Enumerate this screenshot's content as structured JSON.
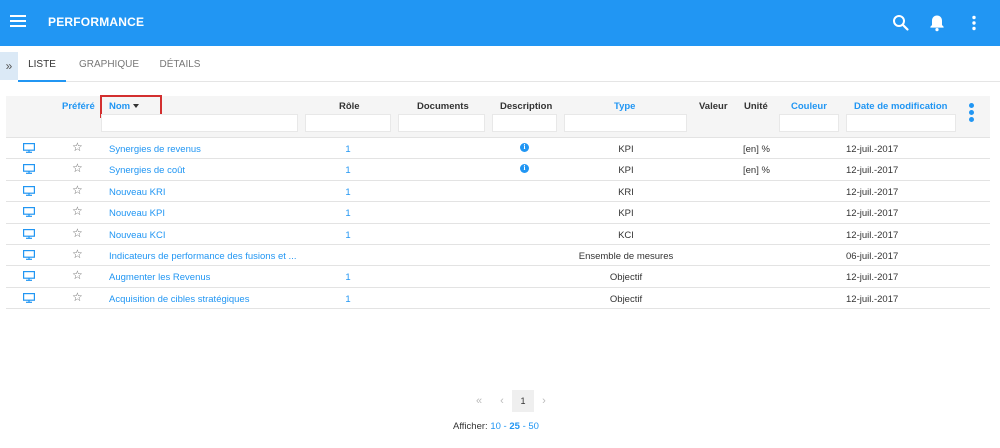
{
  "app": {
    "title": "PERFORMANCE",
    "accent_color": "#2196f3",
    "icons": [
      "menu-icon",
      "search-icon",
      "bell-icon",
      "more-vertical-icon"
    ]
  },
  "side_toggle": {
    "glyph": "»"
  },
  "tabs": [
    {
      "label": "LISTE",
      "active": true
    },
    {
      "label": "GRAPHIQUE",
      "active": false
    },
    {
      "label": "DÉTAILS",
      "active": false
    }
  ],
  "table": {
    "columns": {
      "favorite": "Préféré",
      "name": "Nom",
      "role": "Rôle",
      "documents": "Documents",
      "description": "Description",
      "type": "Type",
      "value": "Valeur",
      "unit": "Unité",
      "color": "Couleur",
      "modified": "Date de modification"
    },
    "sort_column": "Nom",
    "sort_direction": "descending",
    "rows": [
      {
        "name": "Synergies de revenus",
        "role": "1",
        "description_icon": true,
        "type": "KPI",
        "unit": "[en] %",
        "modified": "12-juil.-2017"
      },
      {
        "name": "Synergies de coût",
        "role": "1",
        "description_icon": true,
        "type": "KPI",
        "unit": "[en] %",
        "modified": "12-juil.-2017"
      },
      {
        "name": "Nouveau KRI",
        "role": "1",
        "description_icon": false,
        "type": "KRI",
        "unit": "",
        "modified": "12-juil.-2017"
      },
      {
        "name": "Nouveau KPI",
        "role": "1",
        "description_icon": false,
        "type": "KPI",
        "unit": "",
        "modified": "12-juil.-2017"
      },
      {
        "name": "Nouveau KCI",
        "role": "1",
        "description_icon": false,
        "type": "KCI",
        "unit": "",
        "modified": "12-juil.-2017"
      },
      {
        "name": "Indicateurs de performance des fusions et ...",
        "role": "",
        "description_icon": false,
        "type": "Ensemble de mesures",
        "unit": "",
        "modified": "06-juil.-2017"
      },
      {
        "name": "Augmenter les Revenus",
        "role": "1",
        "description_icon": false,
        "type": "Objectif",
        "unit": "",
        "modified": "12-juil.-2017"
      },
      {
        "name": "Acquisition de cibles stratégiques",
        "role": "1",
        "description_icon": false,
        "type": "Objectif",
        "unit": "",
        "modified": "12-juil.-2017"
      }
    ]
  },
  "pagination": {
    "first": "«",
    "prev": "‹",
    "current_page": "1",
    "next": "›",
    "show_label": "Afficher:",
    "page_sizes": [
      "10",
      "25",
      "50"
    ],
    "selected_page_size": "25",
    "separator": "-"
  }
}
